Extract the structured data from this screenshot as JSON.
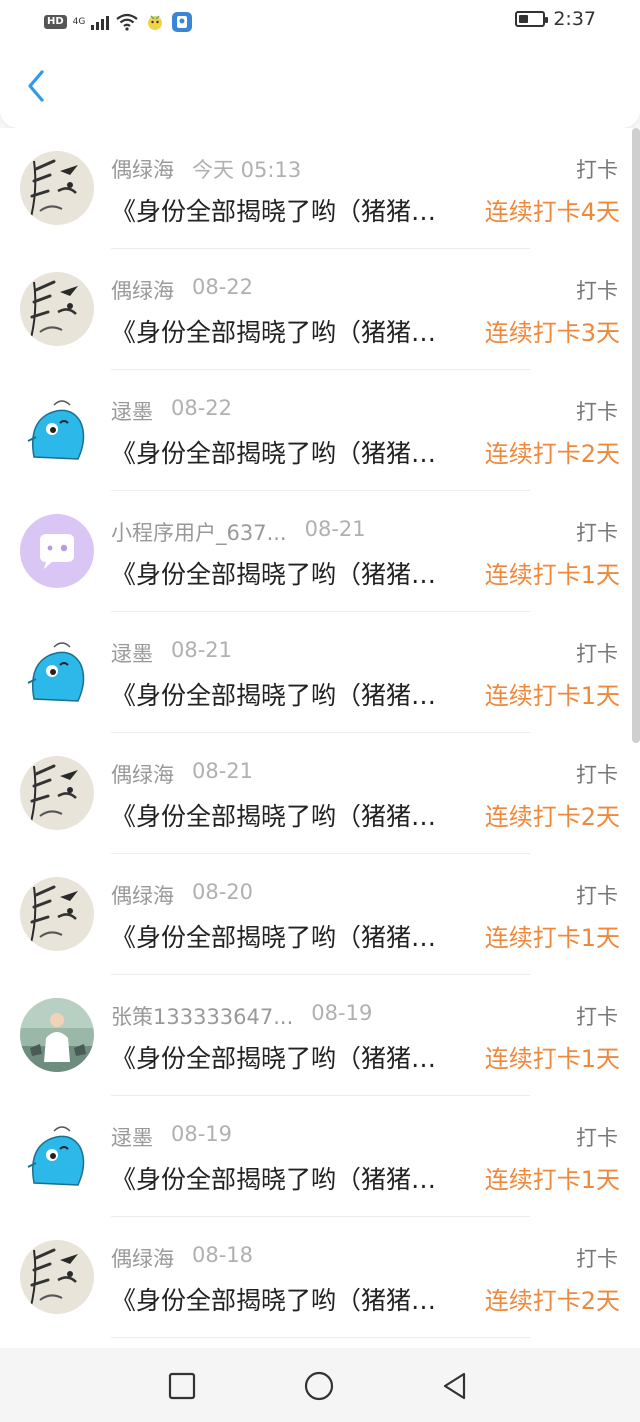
{
  "status_bar": {
    "hd_label": "HD",
    "network_label": "4G",
    "time": "2:37",
    "battery_level": 0.4
  },
  "header": {
    "back_icon": "chevron-left-icon",
    "accent_color": "#2f9ae8"
  },
  "colors": {
    "streak": "#f0883c",
    "name": "#999999",
    "title": "#222222"
  },
  "items": [
    {
      "avatar": "ink-painting",
      "name": "偶绿海",
      "date": "今天 05:13",
      "kind": "打卡",
      "title": "《身份全部揭晓了哟（猪猪…",
      "streak": "连续打卡4天"
    },
    {
      "avatar": "ink-painting",
      "name": "偶绿海",
      "date": "08-22",
      "kind": "打卡",
      "title": "《身份全部揭晓了哟（猪猪…",
      "streak": "连续打卡3天"
    },
    {
      "avatar": "blue-creature",
      "name": "逯墨",
      "date": "08-22",
      "kind": "打卡",
      "title": "《身份全部揭晓了哟（猪猪…",
      "streak": "连续打卡2天"
    },
    {
      "avatar": "purple-chat",
      "name": "小程序用户_637...",
      "date": "08-21",
      "kind": "打卡",
      "title": "《身份全部揭晓了哟（猪猪…",
      "streak": "连续打卡1天"
    },
    {
      "avatar": "blue-creature",
      "name": "逯墨",
      "date": "08-21",
      "kind": "打卡",
      "title": "《身份全部揭晓了哟（猪猪…",
      "streak": "连续打卡1天"
    },
    {
      "avatar": "ink-painting",
      "name": "偶绿海",
      "date": "08-21",
      "kind": "打卡",
      "title": "《身份全部揭晓了哟（猪猪…",
      "streak": "连续打卡2天"
    },
    {
      "avatar": "ink-painting",
      "name": "偶绿海",
      "date": "08-20",
      "kind": "打卡",
      "title": "《身份全部揭晓了哟（猪猪…",
      "streak": "连续打卡1天"
    },
    {
      "avatar": "photo",
      "name": "张策133333647...",
      "date": "08-19",
      "kind": "打卡",
      "title": "《身份全部揭晓了哟（猪猪…",
      "streak": "连续打卡1天"
    },
    {
      "avatar": "blue-creature",
      "name": "逯墨",
      "date": "08-19",
      "kind": "打卡",
      "title": "《身份全部揭晓了哟（猪猪…",
      "streak": "连续打卡1天"
    },
    {
      "avatar": "ink-painting",
      "name": "偶绿海",
      "date": "08-18",
      "kind": "打卡",
      "title": "《身份全部揭晓了哟（猪猪…",
      "streak": "连续打卡2天"
    }
  ],
  "navbar": {
    "recent_icon": "square-icon",
    "home_icon": "circle-icon",
    "back_icon": "triangle-back-icon"
  }
}
